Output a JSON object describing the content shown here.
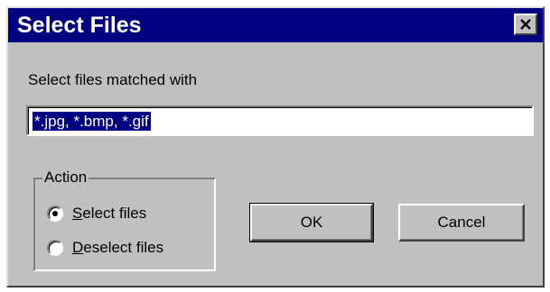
{
  "window": {
    "title": "Select Files",
    "close_icon": "close-icon"
  },
  "prompt": {
    "label": "Select files matched  with"
  },
  "pattern_field": {
    "value": "*.jpg, *.bmp, *.gif",
    "selected": true
  },
  "action_group": {
    "legend": "Action",
    "options": [
      {
        "accel": "S",
        "rest": "elect files",
        "checked": true
      },
      {
        "accel": "D",
        "rest": "eselect files",
        "checked": false
      }
    ]
  },
  "buttons": {
    "ok_label": "OK",
    "cancel_label": "Cancel"
  },
  "colors": {
    "titlebar": "#000080",
    "face": "#c0c0c0",
    "selection": "#000080"
  }
}
